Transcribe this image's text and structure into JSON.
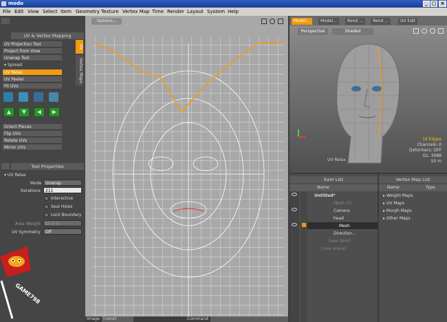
{
  "window": {
    "title": "modo"
  },
  "menu": [
    "File",
    "Edit",
    "View",
    "Select",
    "Item",
    "Geometry",
    "Texture",
    "Vertex Map",
    "Time",
    "Render",
    "Layout",
    "System",
    "Help"
  ],
  "left_panel": {
    "title": "UV & Vertex Mapping",
    "tools": [
      "UV Projection Tool",
      "Project from View",
      "Unwrap Tool"
    ],
    "spread_label": "Spread",
    "tools2": [
      "UV Relax",
      "UV Peeler",
      "Fit UVs"
    ],
    "tools3": [
      "Orient Pieces",
      "Flip UVs",
      "Rotate UVs",
      "Mirror UVs"
    ],
    "vtab_uv": "UV",
    "vtab_vmaps": "Vertex Maps",
    "props_title": "Tool Properties",
    "props_tool": "UV Relax",
    "mode_label": "Mode",
    "mode_value": "Unwrap",
    "iterations_label": "Iterations",
    "iterations_value": "211",
    "interactive": "Interactive",
    "seal_holes": "Seal Holes",
    "lock_boundary": "Lock Boundary",
    "area_weight_label": "Area Weight",
    "area_weight_value": "50.0 %",
    "uv_symmetry_label": "UV Symmetry",
    "uv_symmetry_value": "Off"
  },
  "uv_view": {
    "options_label": "Options..."
  },
  "model_view": {
    "tabs": [
      "Model...",
      "Model...",
      "Rend ...",
      "Rend ...",
      "UV Edit"
    ],
    "perspective": "Perspective",
    "shaded": "Shaded",
    "stats": [
      "14 Edges",
      "Channels: 0",
      "Deformers: OFF",
      "GL: 3088",
      "50 m"
    ],
    "corner_label": "UV Relax"
  },
  "item_list": {
    "title": "Item List",
    "col_name": "Name",
    "rows": [
      "Untitled*",
      "Mesh (2)",
      "Camera",
      "head",
      "Mesh",
      "Direction...",
      "(new item)",
      "(new scene)"
    ]
  },
  "vmap_list": {
    "title": "Vertex Map List",
    "col_name": "Name",
    "col_type": "Type",
    "rows": [
      "Weight Maps",
      "UV Maps",
      "Morph Maps",
      "Other Maps"
    ]
  },
  "bottom": {
    "image_label": "Image",
    "image_value": "(none)",
    "command_label": "Command"
  },
  "watermark": {
    "logo_text": "GAME798"
  },
  "colors": {
    "accent": "#f39a10",
    "menu": "#d6d3ce",
    "panel": "#454545"
  }
}
